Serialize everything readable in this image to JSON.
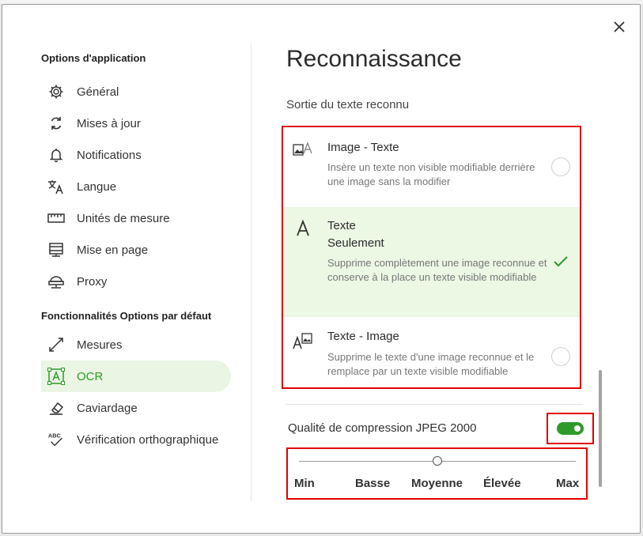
{
  "dialog": {
    "close_icon": "close-icon"
  },
  "sidebar": {
    "app_section": "Options d'application",
    "app_items": [
      {
        "label": "Général",
        "icon": "gear-icon"
      },
      {
        "label": "Mises à jour",
        "icon": "refresh-icon"
      },
      {
        "label": "Notifications",
        "icon": "bell-icon"
      },
      {
        "label": "Langue",
        "icon": "translate-icon"
      },
      {
        "label": "Unités de mesure",
        "icon": "ruler-icon"
      },
      {
        "label": "Mise en page",
        "icon": "layout-icon"
      },
      {
        "label": "Proxy",
        "icon": "network-icon"
      }
    ],
    "features_section": "Fonctionnalités Options par défaut",
    "feature_items": [
      {
        "label": "Mesures",
        "icon": "measure-icon"
      },
      {
        "label": "OCR",
        "icon": "ocr-icon",
        "active": true
      },
      {
        "label": "Caviardage",
        "icon": "eraser-icon"
      },
      {
        "label": "Vérification orthographique",
        "icon": "spellcheck-icon"
      }
    ]
  },
  "main": {
    "title": "Reconnaissance",
    "output_label": "Sortie du texte reconnu",
    "options": [
      {
        "title": "Image - Texte",
        "description": "Insère un texte non visible modifiable derrière une image sans la modifier",
        "icon": "image-text-icon",
        "selected": false
      },
      {
        "title": "Texte",
        "title_line2": "Seulement",
        "description": "Supprime complètement une image reconnue et conserve à la place un texte visible modifiable",
        "icon": "text-only-icon",
        "selected": true
      },
      {
        "title": "Texte - Image",
        "description": "Supprime le texte d'une image reconnue et le remplace par un texte visible modifiable",
        "icon": "text-image-icon",
        "selected": false
      }
    ],
    "jpeg_label": "Qualité de compression JPEG 2000",
    "jpeg_enabled": true,
    "quality": {
      "levels": [
        "Min",
        "Basse",
        "Moyenne",
        "Élevée",
        "Max"
      ],
      "selected": "Moyenne"
    }
  },
  "colors": {
    "accent": "#2e9a2a",
    "selected_bg": "#ecf7e4",
    "highlight_box": "#e00000"
  }
}
